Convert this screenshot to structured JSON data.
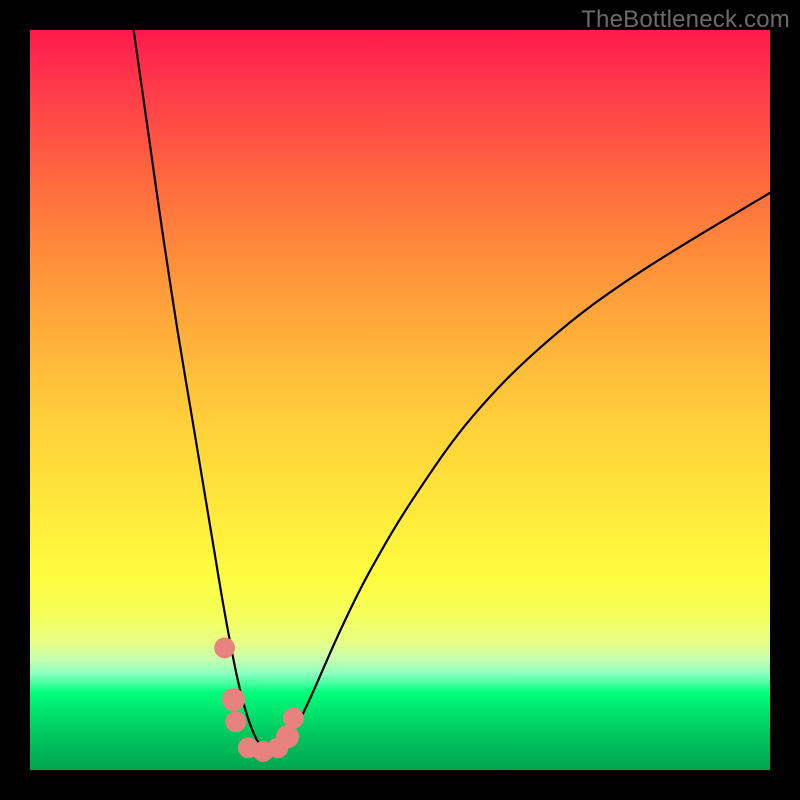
{
  "watermark": "TheBottleneck.com",
  "colors": {
    "frame_bg_top": "#ff1a4d",
    "frame_bg_bottom": "#00a54e",
    "curve": "#000000",
    "marker": "#e8827f",
    "page_bg": "#000000",
    "watermark_text": "#6b6b6b"
  },
  "chart_data": {
    "type": "line",
    "title": "",
    "xlabel": "",
    "ylabel": "",
    "xlim": [
      0,
      100
    ],
    "ylim": [
      0,
      100
    ],
    "grid": false,
    "legend": false,
    "series": [
      {
        "name": "bottleneck-curve",
        "x": [
          14,
          16,
          18,
          20,
          22,
          24,
          25,
          26,
          27,
          28,
          29,
          30,
          31,
          32,
          33,
          34,
          36,
          38,
          42,
          46,
          52,
          60,
          70,
          82,
          100
        ],
        "y": [
          100,
          86,
          72,
          59,
          47,
          35,
          29,
          23,
          17.5,
          12.5,
          8.5,
          5.5,
          3.5,
          2.5,
          2.5,
          3.2,
          6,
          10,
          19,
          27,
          37,
          48,
          58,
          67,
          78
        ]
      }
    ],
    "markers": {
      "name": "highlight-points",
      "points": [
        {
          "x": 26.3,
          "y": 16.5,
          "r": 1.2
        },
        {
          "x": 27.5,
          "y": 9.5,
          "r": 1.5
        },
        {
          "x": 27.8,
          "y": 6.5,
          "r": 1.2
        },
        {
          "x": 29.5,
          "y": 3.0,
          "r": 1.2
        },
        {
          "x": 31.5,
          "y": 2.5,
          "r": 1.2
        },
        {
          "x": 33.5,
          "y": 3.0,
          "r": 1.2
        },
        {
          "x": 34.8,
          "y": 4.5,
          "r": 1.5
        },
        {
          "x": 35.6,
          "y": 7.0,
          "r": 1.2
        }
      ]
    }
  }
}
